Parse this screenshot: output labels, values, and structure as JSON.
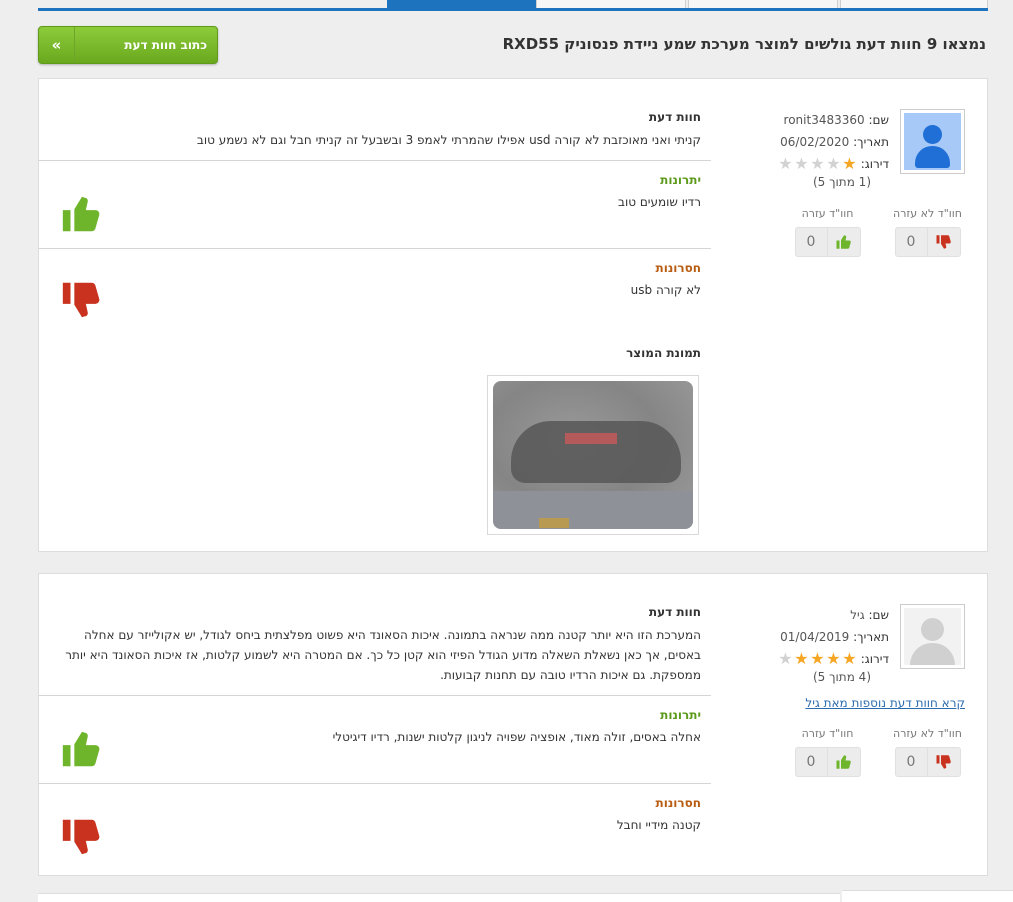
{
  "header": {
    "title": "נמצאו 9 חוות דעת גולשים למוצר מערכת שמע ניידת פנסוניק RXD55",
    "write_button_label": "כתוב חוות דעת",
    "write_button_icon": "double-chevron-icon"
  },
  "labels": {
    "name": "שם:",
    "date": "תאריך:",
    "rating": "דירוג:",
    "not_helpful": "חוו\"ד לא עזרה",
    "helpful": "חוו\"ד עזרה",
    "opinion": "חוות דעת",
    "pros": "יתרונות",
    "cons": "חסרונות",
    "product_image": "תמונת המוצר"
  },
  "colors": {
    "accent_blue": "#1e73be",
    "button_green": "#7cbd2c",
    "pros_green": "#5b9a1a",
    "cons_orange": "#b85c12",
    "star_gold": "#f5a623",
    "thumb_up_green": "#6eb52b",
    "thumb_down_red": "#c8321e"
  },
  "reviews": [
    {
      "name": "ronit3483360",
      "date": "06/02/2020",
      "rating": 1,
      "rating_of": "(1 מתוך 5)",
      "avatar": "blue-user-avatar-icon",
      "not_helpful_count": "0",
      "helpful_count": "0",
      "opinion": "קניתי ואני מאוכזבת לא קורה usd אפילו שהמרתי לאמפ 3 ובשבעל זה קניתי חבל וגם לא נשמע טוב",
      "pros": "רדיו שומעים טוב",
      "cons": "לא קורה usb",
      "has_product_image": true
    },
    {
      "name": "גיל",
      "date": "01/04/2019",
      "rating": 4,
      "rating_of": "(4 מתוך 5)",
      "avatar": "grey-user-avatar-icon",
      "more_link": "קרא חוות דעת נוספות מאת גיל",
      "not_helpful_count": "0",
      "helpful_count": "0",
      "opinion": "המערכת הזו היא יותר קטנה ממה שנראה בתמונה. איכות הסאונד היא פשוט מפלצתית ביחס לגודל, יש אקולייזר עם אחלה באסים, אך כאן נשאלת השאלה מדוע הגודל הפיזי הוא קטן כל כך. אם המטרה היא לשמוע קלטות, אז איכות הסאונד היא יותר ממספקת. גם איכות הרדיו טובה עם תחנות קבועות.",
      "pros": "אחלה באסים, זולה מאוד, אופציה שפויה לניגון קלטות ישנות, רדיו דיגיטלי",
      "cons": "קטנה מידיי וחבל"
    }
  ]
}
